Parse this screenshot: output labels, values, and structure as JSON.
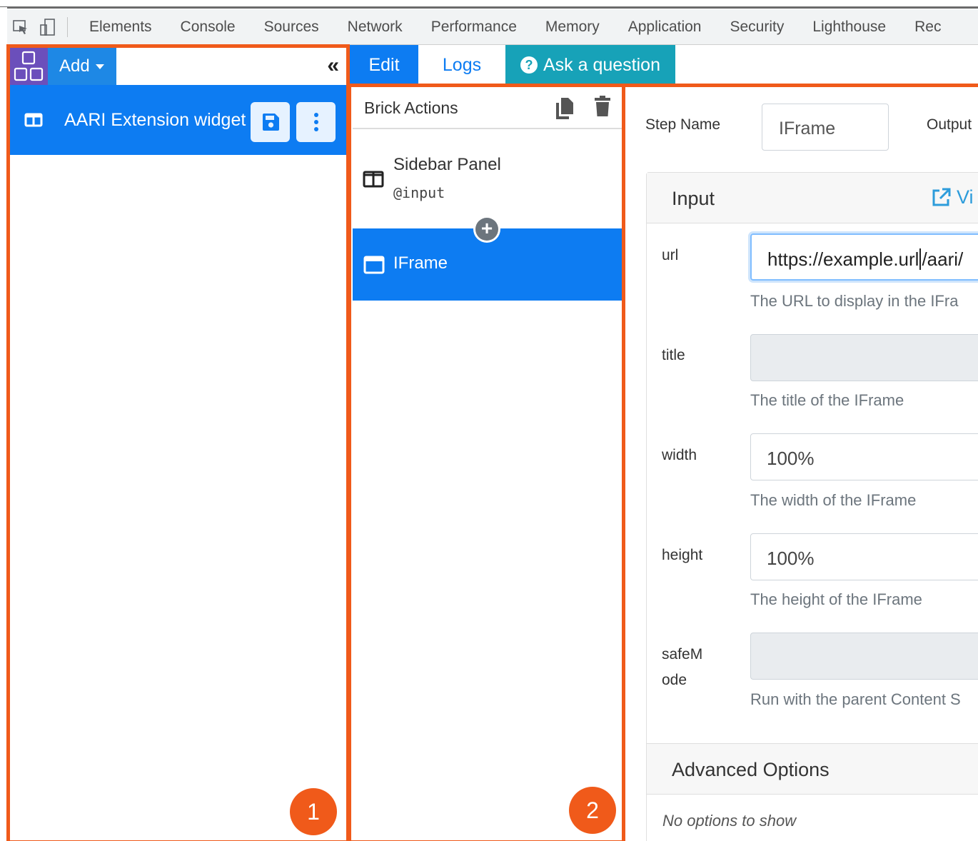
{
  "devtools": {
    "tabs": [
      "Elements",
      "Console",
      "Sources",
      "Network",
      "Performance",
      "Memory",
      "Application",
      "Security",
      "Lighthouse",
      "Rec"
    ]
  },
  "sidebar": {
    "add_label": "Add",
    "widget_label": "AARI Extension widget"
  },
  "editor_tabs": {
    "edit": "Edit",
    "logs": "Logs",
    "ask": "Ask a question"
  },
  "brick_actions": {
    "title": "Brick Actions",
    "items": [
      {
        "title": "Sidebar Panel",
        "subtitle": "@input"
      },
      {
        "title": "IFrame",
        "subtitle": ""
      }
    ]
  },
  "step": {
    "name_label": "Step Name",
    "name_value": "IFrame",
    "output_label": "Output"
  },
  "input_card": {
    "title": "Input",
    "view_link": "Vi",
    "fields": [
      {
        "label": "url",
        "value_before": "https://example.url",
        "value_after": "/aari/",
        "help": "The URL to display in the IFra"
      },
      {
        "label": "title",
        "value": "",
        "help": "The title of the IFrame"
      },
      {
        "label": "width",
        "value": "100%",
        "help": "The width of the IFrame"
      },
      {
        "label": "height",
        "value": "100%",
        "help": "The height of the IFrame"
      },
      {
        "label_line1": "safeM",
        "label_line2": "ode",
        "value": "",
        "help": "Run with the parent Content S"
      }
    ]
  },
  "advanced": {
    "title": "Advanced Options",
    "empty": "No options to show"
  },
  "annotations": {
    "badge1": "1",
    "badge2": "2"
  },
  "colors": {
    "primary": "#0d7cf2",
    "info": "#17a2b8",
    "annotation": "#f05a1a",
    "logo": "#6b4fbb"
  }
}
